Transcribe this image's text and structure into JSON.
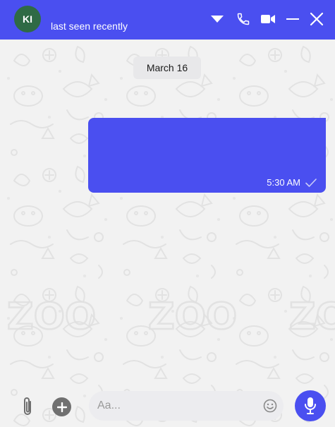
{
  "header": {
    "avatar_initials": "KI",
    "status": "last seen recently",
    "icons": [
      "dropdown-icon",
      "phone-icon",
      "video-camera-icon",
      "minimize-icon",
      "close-icon"
    ],
    "color": "#4a4ff0"
  },
  "conversation": {
    "date_label": "March 16",
    "messages": [
      {
        "direction": "outgoing",
        "text": "",
        "time": "5:30 AM",
        "status": "sent"
      }
    ]
  },
  "composer": {
    "placeholder": "Aa...",
    "value": "",
    "icons": [
      "paperclip-icon",
      "plus-icon",
      "emoji-icon",
      "microphone-icon"
    ]
  },
  "colors": {
    "accent": "#4a4ff0",
    "avatar": "#2f6a45",
    "background": "#f2f2f2"
  }
}
